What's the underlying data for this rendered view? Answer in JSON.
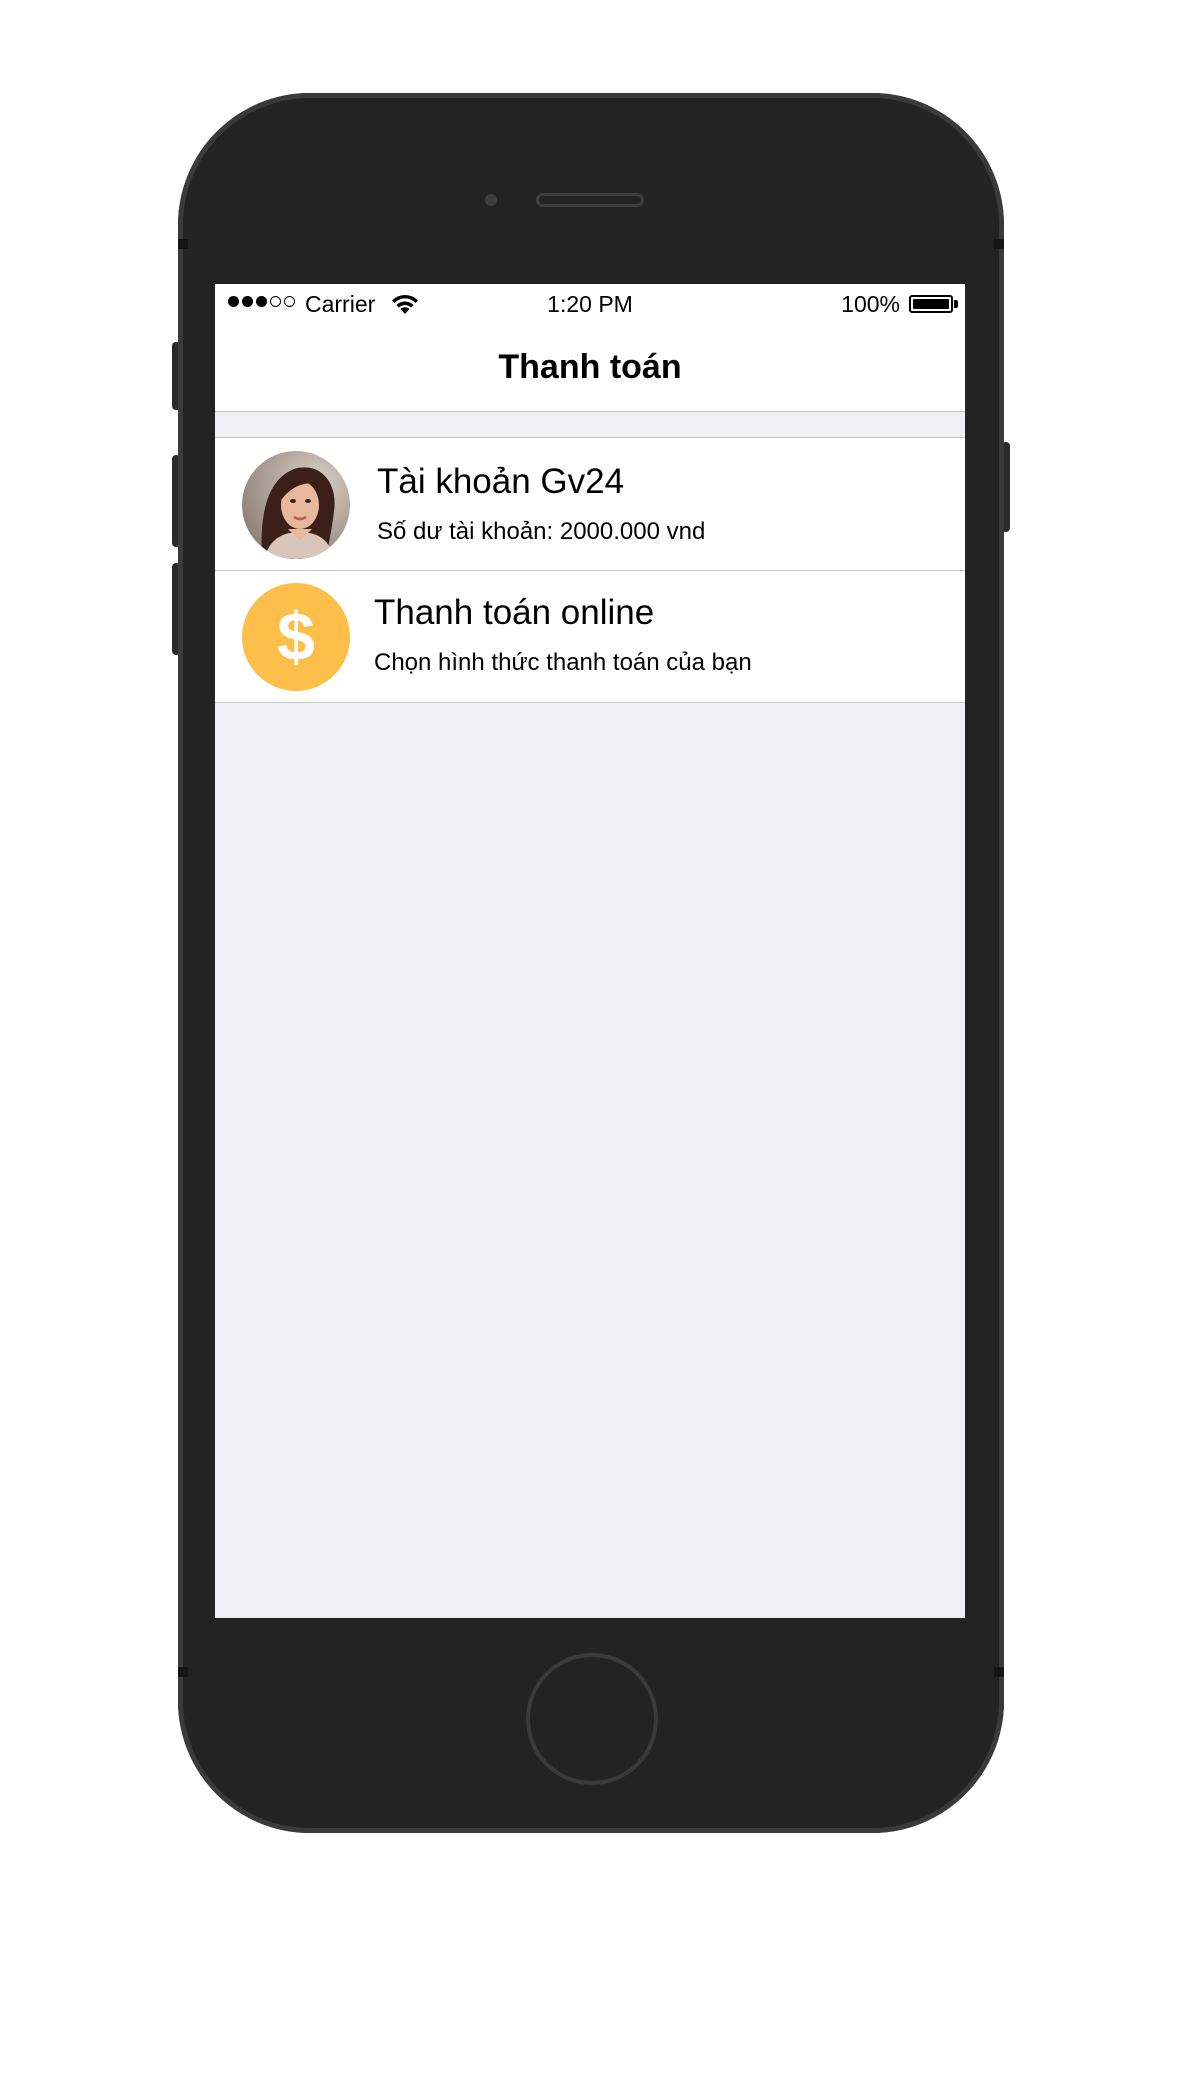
{
  "status_bar": {
    "carrier": "Carrier",
    "time": "1:20 PM",
    "battery_percent": "100%",
    "signal_bars_filled": 3,
    "signal_bars_total": 5
  },
  "nav": {
    "title": "Thanh toán"
  },
  "list": {
    "account": {
      "title": "Tài khoản Gv24",
      "subtitle": "Số dư tài khoản: 2000.000 vnd",
      "icon": "user-avatar"
    },
    "online_payment": {
      "title": "Thanh toán online",
      "subtitle": "Chọn hình thức thanh toán của bạn",
      "icon": "dollar-icon",
      "icon_glyph": "$",
      "icon_color": "#fdbe4a"
    }
  },
  "colors": {
    "screen_background": "#efeff4",
    "separator": "#c8c7cc",
    "phone_body": "#232323"
  }
}
